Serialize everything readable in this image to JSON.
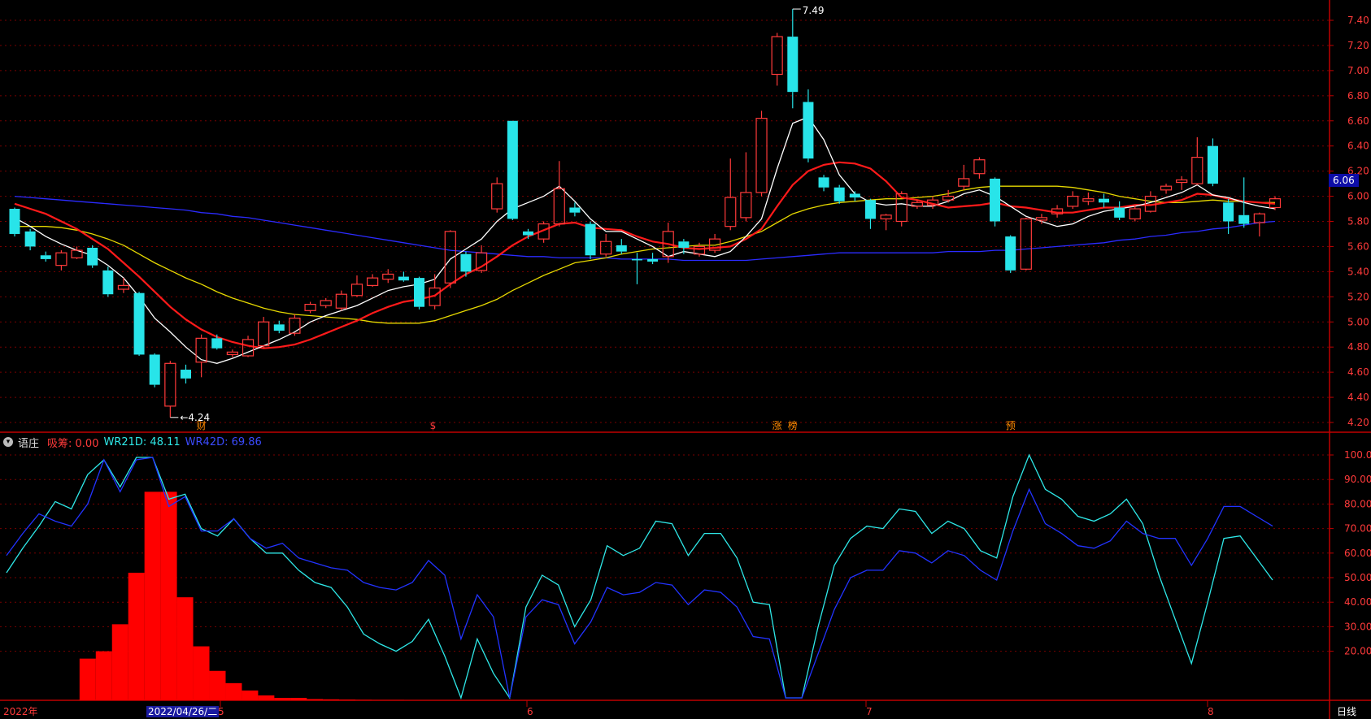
{
  "colors": {
    "up": "#ff3a3a",
    "down": "#28e4e9",
    "ma5": "#ffffff",
    "ma10": "#ff1a1a",
    "ma20": "#e6d800",
    "ma60": "#2b2bff",
    "grid": "#7a0000",
    "axis_text": "#ff3a3a",
    "wr21": "#2ee8e8",
    "wr42": "#2233ff",
    "accum": "#ff0000"
  },
  "header": {
    "indicator_name": "语庄",
    "accum_label": "吸筹: 0.00",
    "wr21_label": "WR21D: 48.11",
    "wr42_label": "WR42D: 69.86"
  },
  "time_axis": {
    "year_label": "2022年",
    "selected_date": "2022/04/26/二",
    "month_5": "5",
    "month_6": "6",
    "month_7": "7",
    "month_8": "8",
    "mode_label": "日线"
  },
  "price_tag": "6.06",
  "chart_data": [
    {
      "type": "candlestick",
      "title": "",
      "ylim": [
        4.1,
        7.55
      ],
      "yticks": [
        "7.40",
        "7.20",
        "7.00",
        "6.80",
        "6.60",
        "6.40",
        "6.20",
        "6.00",
        "5.80",
        "5.60",
        "5.40",
        "5.20",
        "5.00",
        "4.80",
        "4.60",
        "4.40",
        "4.20"
      ],
      "annotations": {
        "high_label": "7.49",
        "low_label": "4.24"
      },
      "markers": [
        "财",
        "$",
        "涨",
        "榜",
        "预"
      ],
      "candles": [
        [
          5.9,
          5.7,
          5.91,
          5.68
        ],
        [
          5.72,
          5.6,
          5.74,
          5.57
        ],
        [
          5.53,
          5.5,
          5.56,
          5.48
        ],
        [
          5.45,
          5.55,
          5.57,
          5.41
        ],
        [
          5.51,
          5.57,
          5.6,
          5.5
        ],
        [
          5.59,
          5.45,
          5.61,
          5.43
        ],
        [
          5.41,
          5.22,
          5.44,
          5.2
        ],
        [
          5.26,
          5.29,
          5.35,
          5.23
        ],
        [
          5.23,
          4.74,
          5.24,
          4.73
        ],
        [
          4.74,
          4.5,
          4.75,
          4.48
        ],
        [
          4.33,
          4.67,
          4.69,
          4.24
        ],
        [
          4.62,
          4.55,
          4.66,
          4.51
        ],
        [
          4.68,
          4.87,
          4.9,
          4.56
        ],
        [
          4.87,
          4.79,
          4.9,
          4.78
        ],
        [
          4.74,
          4.76,
          4.78,
          4.72
        ],
        [
          4.73,
          4.86,
          4.89,
          4.72
        ],
        [
          4.81,
          5.0,
          5.04,
          4.79
        ],
        [
          4.98,
          4.93,
          5.01,
          4.91
        ],
        [
          4.91,
          5.03,
          5.06,
          4.89
        ],
        [
          5.09,
          5.14,
          5.16,
          5.07
        ],
        [
          5.13,
          5.17,
          5.19,
          5.11
        ],
        [
          5.11,
          5.22,
          5.25,
          5.09
        ],
        [
          5.21,
          5.3,
          5.37,
          5.2
        ],
        [
          5.29,
          5.35,
          5.38,
          5.28
        ],
        [
          5.34,
          5.38,
          5.42,
          5.31
        ],
        [
          5.36,
          5.33,
          5.4,
          5.32
        ],
        [
          5.35,
          5.12,
          5.36,
          5.1
        ],
        [
          5.13,
          5.27,
          5.38,
          5.1
        ],
        [
          5.31,
          5.72,
          5.73,
          5.27
        ],
        [
          5.54,
          5.4,
          5.56,
          5.36
        ],
        [
          5.41,
          5.55,
          5.61,
          5.39
        ],
        [
          5.9,
          6.1,
          6.15,
          5.87
        ],
        [
          6.6,
          5.82,
          6.6,
          5.81
        ],
        [
          5.72,
          5.69,
          5.74,
          5.66
        ],
        [
          5.66,
          5.78,
          5.8,
          5.63
        ],
        [
          5.78,
          6.06,
          6.28,
          5.76
        ],
        [
          5.91,
          5.87,
          5.95,
          5.84
        ],
        [
          5.78,
          5.53,
          5.8,
          5.5
        ],
        [
          5.54,
          5.64,
          5.7,
          5.52
        ],
        [
          5.61,
          5.56,
          5.66,
          5.54
        ],
        [
          5.5,
          5.49,
          5.55,
          5.3
        ],
        [
          5.5,
          5.48,
          5.55,
          5.46
        ],
        [
          5.52,
          5.72,
          5.79,
          5.47
        ],
        [
          5.64,
          5.59,
          5.66,
          5.54
        ],
        [
          5.54,
          5.6,
          5.63,
          5.52
        ],
        [
          5.57,
          5.66,
          5.7,
          5.55
        ],
        [
          5.76,
          5.99,
          6.3,
          5.73
        ],
        [
          5.83,
          6.03,
          6.35,
          5.8
        ],
        [
          6.03,
          6.62,
          6.68,
          6.0
        ],
        [
          6.97,
          7.27,
          7.3,
          6.88
        ],
        [
          7.27,
          6.83,
          7.49,
          6.7
        ],
        [
          6.75,
          6.3,
          6.85,
          6.27
        ],
        [
          6.15,
          6.07,
          6.17,
          6.04
        ],
        [
          6.07,
          5.96,
          6.09,
          5.94
        ],
        [
          6.02,
          5.99,
          6.04,
          5.96
        ],
        [
          5.97,
          5.82,
          5.98,
          5.74
        ],
        [
          5.82,
          5.85,
          5.86,
          5.73
        ],
        [
          5.8,
          6.02,
          6.04,
          5.76
        ],
        [
          5.92,
          5.95,
          5.97,
          5.9
        ],
        [
          5.93,
          5.97,
          6.0,
          5.9
        ],
        [
          5.97,
          6.0,
          6.05,
          5.95
        ],
        [
          6.08,
          6.14,
          6.25,
          6.05
        ],
        [
          6.18,
          6.29,
          6.31,
          6.14
        ],
        [
          6.14,
          5.8,
          6.15,
          5.76
        ],
        [
          5.68,
          5.41,
          5.69,
          5.39
        ],
        [
          5.42,
          5.82,
          5.83,
          5.41
        ],
        [
          5.81,
          5.83,
          5.86,
          5.78
        ],
        [
          5.86,
          5.9,
          5.93,
          5.83
        ],
        [
          5.92,
          6.0,
          6.04,
          5.9
        ],
        [
          5.96,
          5.98,
          6.03,
          5.93
        ],
        [
          5.98,
          5.95,
          6.02,
          5.91
        ],
        [
          5.91,
          5.83,
          5.96,
          5.81
        ],
        [
          5.82,
          5.9,
          5.93,
          5.8
        ],
        [
          5.88,
          6.0,
          6.04,
          5.87
        ],
        [
          6.05,
          6.08,
          6.1,
          6.02
        ],
        [
          6.11,
          6.13,
          6.16,
          6.05
        ],
        [
          6.1,
          6.31,
          6.47,
          6.09
        ],
        [
          6.4,
          6.1,
          6.46,
          6.08
        ],
        [
          5.95,
          5.8,
          5.98,
          5.7
        ],
        [
          5.85,
          5.78,
          6.15,
          5.75
        ],
        [
          5.79,
          5.86,
          5.87,
          5.68
        ],
        [
          5.91,
          5.98,
          6.0,
          5.89
        ]
      ],
      "ma5": [
        5.83,
        5.76,
        5.68,
        5.62,
        5.57,
        5.53,
        5.45,
        5.35,
        5.2,
        5.03,
        4.92,
        4.8,
        4.7,
        4.67,
        4.71,
        4.76,
        4.81,
        4.86,
        4.92,
        5.0,
        5.05,
        5.09,
        5.13,
        5.19,
        5.25,
        5.28,
        5.3,
        5.34,
        5.5,
        5.58,
        5.66,
        5.8,
        5.9,
        5.95,
        6.0,
        6.08,
        5.96,
        5.82,
        5.72,
        5.72,
        5.66,
        5.6,
        5.52,
        5.56,
        5.54,
        5.52,
        5.56,
        5.68,
        5.82,
        6.22,
        6.58,
        6.63,
        6.45,
        6.17,
        6.02,
        5.95,
        5.93,
        5.94,
        5.92,
        5.92,
        5.96,
        6.02,
        6.05,
        6.0,
        5.92,
        5.84,
        5.8,
        5.76,
        5.78,
        5.84,
        5.88,
        5.9,
        5.92,
        5.95,
        5.99,
        6.03,
        6.09,
        6.01,
        5.99,
        5.95,
        5.92,
        5.9
      ],
      "ma10": [
        5.94,
        5.9,
        5.86,
        5.8,
        5.74,
        5.66,
        5.58,
        5.47,
        5.36,
        5.24,
        5.12,
        5.02,
        4.94,
        4.88,
        4.84,
        4.81,
        4.79,
        4.8,
        4.82,
        4.86,
        4.91,
        4.96,
        5.01,
        5.07,
        5.12,
        5.16,
        5.18,
        5.21,
        5.3,
        5.38,
        5.44,
        5.52,
        5.61,
        5.68,
        5.73,
        5.78,
        5.79,
        5.75,
        5.74,
        5.73,
        5.68,
        5.64,
        5.62,
        5.59,
        5.58,
        5.59,
        5.6,
        5.66,
        5.74,
        5.92,
        6.09,
        6.2,
        6.25,
        6.27,
        6.26,
        6.22,
        6.12,
        5.99,
        5.97,
        5.94,
        5.91,
        5.92,
        5.93,
        5.95,
        5.92,
        5.91,
        5.89,
        5.87,
        5.87,
        5.89,
        5.91,
        5.91,
        5.93,
        5.93,
        5.95,
        5.97,
        6.02,
        6.01,
        5.98,
        5.96,
        5.95,
        5.94
      ],
      "ma20": [
        5.76,
        5.76,
        5.76,
        5.75,
        5.73,
        5.7,
        5.66,
        5.61,
        5.54,
        5.47,
        5.41,
        5.35,
        5.3,
        5.24,
        5.19,
        5.15,
        5.11,
        5.08,
        5.06,
        5.05,
        5.04,
        5.03,
        5.02,
        5.0,
        4.99,
        4.99,
        4.99,
        5.01,
        5.05,
        5.09,
        5.13,
        5.18,
        5.25,
        5.31,
        5.37,
        5.42,
        5.47,
        5.49,
        5.51,
        5.54,
        5.56,
        5.58,
        5.59,
        5.6,
        5.61,
        5.61,
        5.64,
        5.68,
        5.72,
        5.79,
        5.86,
        5.9,
        5.93,
        5.95,
        5.96,
        5.97,
        5.98,
        5.98,
        5.99,
        6.0,
        6.02,
        6.05,
        6.07,
        6.08,
        6.08,
        6.08,
        6.08,
        6.08,
        6.07,
        6.05,
        6.03,
        6.0,
        5.98,
        5.96,
        5.95,
        5.95,
        5.96,
        5.97,
        5.96,
        5.96,
        5.95,
        5.95
      ],
      "ma60": [
        6.0,
        5.99,
        5.98,
        5.97,
        5.96,
        5.95,
        5.94,
        5.93,
        5.92,
        5.91,
        5.9,
        5.89,
        5.87,
        5.86,
        5.84,
        5.83,
        5.81,
        5.79,
        5.77,
        5.75,
        5.73,
        5.71,
        5.69,
        5.67,
        5.65,
        5.63,
        5.61,
        5.59,
        5.57,
        5.56,
        5.55,
        5.54,
        5.53,
        5.52,
        5.52,
        5.51,
        5.51,
        5.51,
        5.51,
        5.5,
        5.5,
        5.5,
        5.5,
        5.49,
        5.49,
        5.49,
        5.49,
        5.49,
        5.5,
        5.51,
        5.52,
        5.53,
        5.54,
        5.55,
        5.55,
        5.55,
        5.55,
        5.55,
        5.55,
        5.55,
        5.56,
        5.56,
        5.56,
        5.57,
        5.57,
        5.58,
        5.59,
        5.6,
        5.61,
        5.62,
        5.63,
        5.65,
        5.66,
        5.68,
        5.69,
        5.71,
        5.72,
        5.74,
        5.75,
        5.77,
        5.79,
        5.8
      ]
    },
    {
      "type": "line",
      "title": "",
      "ylim": [
        0,
        105
      ],
      "yticks": [
        "100.00",
        "90.00",
        "80.00",
        "70.00",
        "60.00",
        "50.00",
        "40.00",
        "30.00",
        "20.00"
      ],
      "series": [
        {
          "name": "WR21D",
          "values": [
            52,
            62,
            71,
            81,
            78,
            92,
            98,
            87,
            99,
            99,
            82,
            84,
            70,
            67,
            74,
            66,
            60,
            60,
            53,
            48,
            46,
            38,
            27,
            23,
            20,
            24,
            33,
            18,
            1,
            25,
            11,
            1,
            38,
            51,
            47,
            30,
            41,
            63,
            59,
            62,
            73,
            72,
            59,
            68,
            68,
            58,
            40,
            39,
            1,
            1,
            30,
            55,
            66,
            71,
            70,
            78,
            77,
            68,
            73,
            70,
            61,
            58,
            83,
            100,
            86,
            82,
            75,
            73,
            76,
            82,
            72,
            51,
            33,
            15,
            40,
            66,
            67,
            58,
            49
          ]
        },
        {
          "name": "WR42D",
          "values": [
            59,
            68,
            76,
            73,
            71,
            80,
            98,
            85,
            98,
            99,
            79,
            83,
            69,
            69,
            74,
            66,
            62,
            64,
            58,
            56,
            54,
            53,
            48,
            46,
            45,
            48,
            57,
            51,
            25,
            43,
            34,
            1,
            34,
            41,
            39,
            23,
            32,
            46,
            43,
            44,
            48,
            47,
            39,
            45,
            44,
            38,
            26,
            25,
            1,
            1,
            19,
            37,
            50,
            53,
            53,
            61,
            60,
            56,
            61,
            59,
            53,
            49,
            69,
            86,
            72,
            68,
            63,
            62,
            65,
            73,
            68,
            66,
            66,
            55,
            66,
            79,
            79,
            75,
            71
          ]
        },
        {
          "name": "吸筹",
          "values": [
            0,
            0,
            0,
            0,
            0,
            17,
            20,
            31,
            52,
            85,
            85,
            42,
            22,
            12,
            7,
            4,
            2,
            1,
            1,
            0.5,
            0.4,
            0.3,
            0.2,
            0.1,
            0.1,
            0,
            0,
            0,
            0,
            0,
            0,
            0,
            0,
            0,
            0,
            0,
            0,
            0,
            0,
            0,
            0,
            0,
            0,
            0,
            0,
            0,
            0,
            0,
            0,
            0,
            0,
            0,
            0,
            0,
            0,
            0,
            0,
            0,
            0,
            0,
            0,
            0,
            0,
            0,
            0,
            0,
            0,
            0,
            0,
            0,
            0,
            0,
            0,
            0,
            0,
            0,
            0,
            0,
            0
          ]
        }
      ]
    }
  ]
}
